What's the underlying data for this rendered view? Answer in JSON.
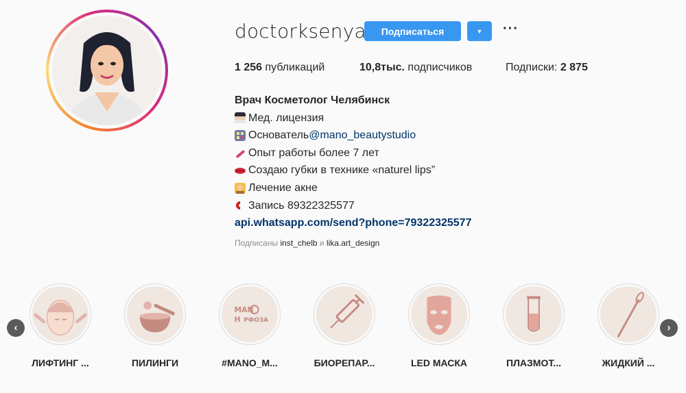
{
  "profile": {
    "username": "doctorksenya",
    "follow_label": "Подписаться",
    "dropdown_glyph": "▼",
    "more_glyph": "···",
    "avatar_icon": "avatar-illustration"
  },
  "stats": {
    "posts_count": "1 256",
    "posts_label": " публикаций",
    "followers_count": "10,8тыс.",
    "followers_label": " подписчиков",
    "following_label": "Подписки: ",
    "following_count": "2 875"
  },
  "bio": {
    "name": "Врач Косметолог Челябинск",
    "lines": [
      {
        "icon": "doctor-emoji",
        "text": "Мед. лицензия"
      },
      {
        "icon": "building-emoji",
        "text": "Основатель ",
        "mention": "@mano_beautystudio"
      },
      {
        "icon": "syringe-emoji",
        "text": "Опыт работы более 7 лет"
      },
      {
        "icon": "lips-emoji",
        "text": "Создаю губки в технике «naturel lips”"
      },
      {
        "icon": "woman-emoji",
        "text": "Лечение акне"
      },
      {
        "icon": "phone-emoji",
        "text": "Запись 89322325577"
      }
    ],
    "link": "api.whatsapp.com/send?phone=79322325577"
  },
  "followed_by": {
    "prefix": "Подписаны ",
    "account1": "inst_chelb",
    "joiner": " и ",
    "account2": "lika.art_design"
  },
  "highlights": [
    {
      "label": "ЛИФТИНГ ...",
      "icon": "face-lifting-icon"
    },
    {
      "label": "ПИЛИНГИ",
      "icon": "peeling-bowl-icon"
    },
    {
      "label": "#MANO_M...",
      "icon": "mano-logo-icon",
      "logo_text_1": "MAN",
      "logo_text_2": "О",
      "logo_text_3": "Н",
      "logo_text_4": "РФОЗА"
    },
    {
      "label": "БИОРЕПАР...",
      "icon": "syringe-icon"
    },
    {
      "label": "LED МАСКА",
      "icon": "led-mask-icon"
    },
    {
      "label": "ПЛАЗМОТ...",
      "icon": "test-tube-icon"
    },
    {
      "label": "ЖИДКИЙ ...",
      "icon": "thread-needle-icon"
    }
  ],
  "nav": {
    "prev_glyph": "‹",
    "next_glyph": "›"
  },
  "colors": {
    "accent": "#3897f0",
    "link": "#003569",
    "highlight_bg": "#f0e7e1",
    "icon_fill": "#e3b3aa"
  }
}
